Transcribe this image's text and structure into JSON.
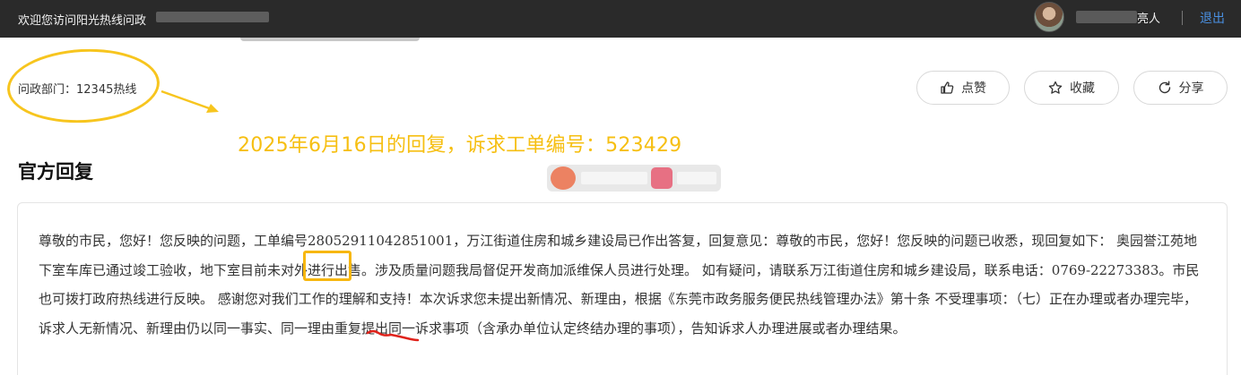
{
  "header": {
    "welcome": "欢迎您访问阳光热线问政",
    "username": "亮人",
    "logout": "退出"
  },
  "department": "问政部门：12345热线",
  "actions": {
    "like": "点赞",
    "favorite": "收藏",
    "share": "分享"
  },
  "annotation": "2025年6月16日的回复，诉求工单编号：523429",
  "section_title": "官方回复",
  "reply_text": "尊敬的市民，您好！您反映的问题，工单编号28052911042851001，万江街道住房和城乡建设局已作出答复，回复意见：尊敬的市民，您好！您反映的问题已收悉，现回复如下： 奥园誉江苑地下室车库已通过竣工验收，地下室目前未对外进行出售。涉及质量问题我局督促开发商加派维保人员进行处理。 如有疑问，请联系万江街道住房和城乡建设局，联系电话：0769-22273383。市民也可拨打政府热线进行反映。 感谢您对我们工作的理解和支持！本次诉求您未提出新情况、新理由，根据《东莞市政务服务便民热线管理办法》第十条 不受理事项：（七）正在办理或者办理完毕，诉求人无新情况、新理由仍以同一事实、同一理由重复提出同一诉求事项（含承办单位认定终结办理的事项），告知诉求人办理进展或者办理结果。",
  "colors": {
    "topbar": "#2a2a2a",
    "annotation": "#f6bf12",
    "logout": "#4a90e2",
    "squiggle": "#e0221b"
  }
}
